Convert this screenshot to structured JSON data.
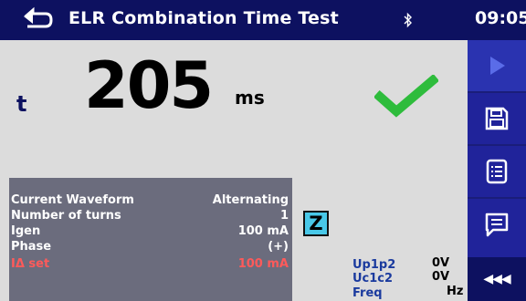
{
  "header": {
    "title": "ELR Combination Time Test",
    "time": "09:05"
  },
  "result": {
    "label": "t",
    "value": "205",
    "unit": "ms",
    "status": "pass"
  },
  "parameters": [
    {
      "label": "Current Waveform",
      "value": "Alternating"
    },
    {
      "label": "Number of turns",
      "value": "1"
    },
    {
      "label": "Igen",
      "value": "100 mA"
    },
    {
      "label": "Phase",
      "value": "(+)"
    },
    {
      "label": "IΔ set",
      "value": "100 mA"
    }
  ],
  "z_indicator": "Z",
  "readings": [
    {
      "label": "Up1p2",
      "value": "0V"
    },
    {
      "label": "Uc1c2",
      "value": "0V"
    },
    {
      "label": "Freq",
      "value": "Hz"
    }
  ],
  "sidebar": {
    "buttons": [
      "play-icon",
      "save-icon",
      "list-icon",
      "comment-icon"
    ],
    "more_label": "◀◀◀"
  },
  "colors": {
    "header_bg": "#0d1160",
    "sidebar_bg": "#20239a",
    "pass_check": "#2ebc3c",
    "panel_bg": "#6b6c7d",
    "warning_red": "#ff5a5a"
  }
}
